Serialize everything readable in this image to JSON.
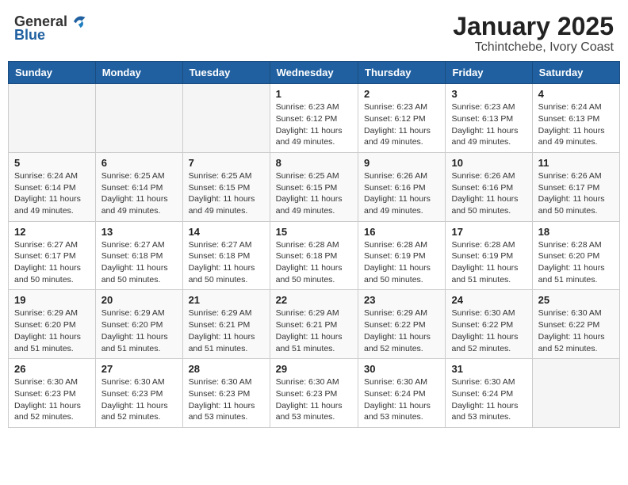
{
  "header": {
    "logo_general": "General",
    "logo_blue": "Blue",
    "month": "January 2025",
    "location": "Tchintchebe, Ivory Coast"
  },
  "weekdays": [
    "Sunday",
    "Monday",
    "Tuesday",
    "Wednesday",
    "Thursday",
    "Friday",
    "Saturday"
  ],
  "weeks": [
    [
      {
        "day": "",
        "info": ""
      },
      {
        "day": "",
        "info": ""
      },
      {
        "day": "",
        "info": ""
      },
      {
        "day": "1",
        "info": "Sunrise: 6:23 AM\nSunset: 6:12 PM\nDaylight: 11 hours\nand 49 minutes."
      },
      {
        "day": "2",
        "info": "Sunrise: 6:23 AM\nSunset: 6:12 PM\nDaylight: 11 hours\nand 49 minutes."
      },
      {
        "day": "3",
        "info": "Sunrise: 6:23 AM\nSunset: 6:13 PM\nDaylight: 11 hours\nand 49 minutes."
      },
      {
        "day": "4",
        "info": "Sunrise: 6:24 AM\nSunset: 6:13 PM\nDaylight: 11 hours\nand 49 minutes."
      }
    ],
    [
      {
        "day": "5",
        "info": "Sunrise: 6:24 AM\nSunset: 6:14 PM\nDaylight: 11 hours\nand 49 minutes."
      },
      {
        "day": "6",
        "info": "Sunrise: 6:25 AM\nSunset: 6:14 PM\nDaylight: 11 hours\nand 49 minutes."
      },
      {
        "day": "7",
        "info": "Sunrise: 6:25 AM\nSunset: 6:15 PM\nDaylight: 11 hours\nand 49 minutes."
      },
      {
        "day": "8",
        "info": "Sunrise: 6:25 AM\nSunset: 6:15 PM\nDaylight: 11 hours\nand 49 minutes."
      },
      {
        "day": "9",
        "info": "Sunrise: 6:26 AM\nSunset: 6:16 PM\nDaylight: 11 hours\nand 49 minutes."
      },
      {
        "day": "10",
        "info": "Sunrise: 6:26 AM\nSunset: 6:16 PM\nDaylight: 11 hours\nand 50 minutes."
      },
      {
        "day": "11",
        "info": "Sunrise: 6:26 AM\nSunset: 6:17 PM\nDaylight: 11 hours\nand 50 minutes."
      }
    ],
    [
      {
        "day": "12",
        "info": "Sunrise: 6:27 AM\nSunset: 6:17 PM\nDaylight: 11 hours\nand 50 minutes."
      },
      {
        "day": "13",
        "info": "Sunrise: 6:27 AM\nSunset: 6:18 PM\nDaylight: 11 hours\nand 50 minutes."
      },
      {
        "day": "14",
        "info": "Sunrise: 6:27 AM\nSunset: 6:18 PM\nDaylight: 11 hours\nand 50 minutes."
      },
      {
        "day": "15",
        "info": "Sunrise: 6:28 AM\nSunset: 6:18 PM\nDaylight: 11 hours\nand 50 minutes."
      },
      {
        "day": "16",
        "info": "Sunrise: 6:28 AM\nSunset: 6:19 PM\nDaylight: 11 hours\nand 50 minutes."
      },
      {
        "day": "17",
        "info": "Sunrise: 6:28 AM\nSunset: 6:19 PM\nDaylight: 11 hours\nand 51 minutes."
      },
      {
        "day": "18",
        "info": "Sunrise: 6:28 AM\nSunset: 6:20 PM\nDaylight: 11 hours\nand 51 minutes."
      }
    ],
    [
      {
        "day": "19",
        "info": "Sunrise: 6:29 AM\nSunset: 6:20 PM\nDaylight: 11 hours\nand 51 minutes."
      },
      {
        "day": "20",
        "info": "Sunrise: 6:29 AM\nSunset: 6:20 PM\nDaylight: 11 hours\nand 51 minutes."
      },
      {
        "day": "21",
        "info": "Sunrise: 6:29 AM\nSunset: 6:21 PM\nDaylight: 11 hours\nand 51 minutes."
      },
      {
        "day": "22",
        "info": "Sunrise: 6:29 AM\nSunset: 6:21 PM\nDaylight: 11 hours\nand 51 minutes."
      },
      {
        "day": "23",
        "info": "Sunrise: 6:29 AM\nSunset: 6:22 PM\nDaylight: 11 hours\nand 52 minutes."
      },
      {
        "day": "24",
        "info": "Sunrise: 6:30 AM\nSunset: 6:22 PM\nDaylight: 11 hours\nand 52 minutes."
      },
      {
        "day": "25",
        "info": "Sunrise: 6:30 AM\nSunset: 6:22 PM\nDaylight: 11 hours\nand 52 minutes."
      }
    ],
    [
      {
        "day": "26",
        "info": "Sunrise: 6:30 AM\nSunset: 6:23 PM\nDaylight: 11 hours\nand 52 minutes."
      },
      {
        "day": "27",
        "info": "Sunrise: 6:30 AM\nSunset: 6:23 PM\nDaylight: 11 hours\nand 52 minutes."
      },
      {
        "day": "28",
        "info": "Sunrise: 6:30 AM\nSunset: 6:23 PM\nDaylight: 11 hours\nand 53 minutes."
      },
      {
        "day": "29",
        "info": "Sunrise: 6:30 AM\nSunset: 6:23 PM\nDaylight: 11 hours\nand 53 minutes."
      },
      {
        "day": "30",
        "info": "Sunrise: 6:30 AM\nSunset: 6:24 PM\nDaylight: 11 hours\nand 53 minutes."
      },
      {
        "day": "31",
        "info": "Sunrise: 6:30 AM\nSunset: 6:24 PM\nDaylight: 11 hours\nand 53 minutes."
      },
      {
        "day": "",
        "info": ""
      }
    ]
  ]
}
